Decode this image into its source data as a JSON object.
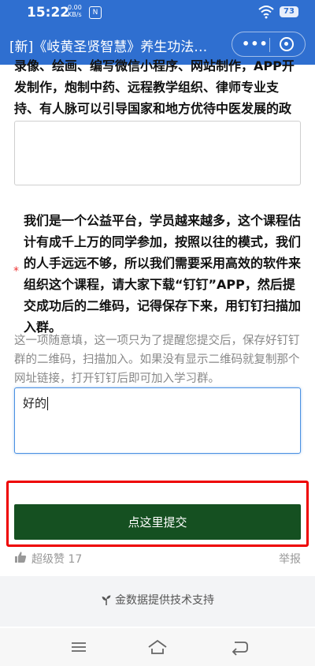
{
  "status_bar": {
    "time": "15:22",
    "speed_value": "0.00",
    "speed_unit": "KB/s",
    "notif_badge": "N",
    "battery": "73"
  },
  "title_bar": {
    "title": "[新]《岐黄圣贤智慧》养生功法…",
    "more_icon": "more-dots-icon",
    "close_icon": "mini-program-close-icon"
  },
  "question_prev": {
    "text": "录像、绘画、编写微信小程序、网站制作，APP开发制作，炮制中药、远程教学组织、律师专业支持、有人脉可以引导国家和地方优待中医发展的政策等",
    "answer": ""
  },
  "question_dingtalk": {
    "required_mark": "*",
    "text": "我们是一个公益平台，学员越来越多，这个课程估计有成千上万的同学参加，按照以往的模式，我们的人手远远不够，所以我们需要采用高效的软件来组织这个课程，请大家下载“钉钉”APP，然后提交成功后的二维码，记得保存下来，用钉钉扫描加入群。",
    "hint": "这一项随意填，这一项只为了提醒您提交后，保存好钉钉群的二维码，扫描加入。如果没有显示二维码就复制那个网址链接，打开钉钉后即可加入学习群。",
    "answer": "好的"
  },
  "submit_label": "点这里提交",
  "like_bar": {
    "like_label": "超级赞 17",
    "report_label": "举报"
  },
  "footer": {
    "text": "金数据提供技术支持"
  },
  "colors": {
    "title_bar_bg": "#2f6fd0",
    "submit_bg": "#155021",
    "highlight_border": "#e00000"
  }
}
